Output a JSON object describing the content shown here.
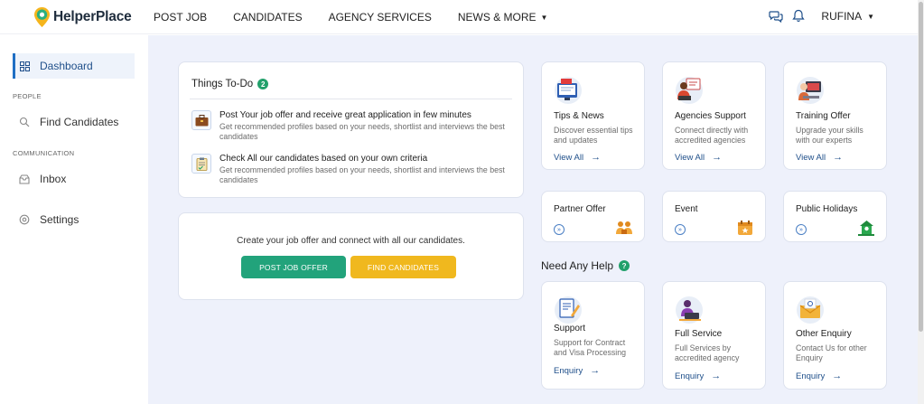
{
  "brand": {
    "name": "HelperPlace"
  },
  "nav": {
    "items": [
      {
        "label": "POST JOB"
      },
      {
        "label": "CANDIDATES"
      },
      {
        "label": "AGENCY SERVICES"
      },
      {
        "label": "NEWS & MORE",
        "has_dropdown": true
      }
    ],
    "user_name": "RUFINA"
  },
  "sidebar": {
    "items": [
      {
        "label": "Dashboard",
        "icon": "grid-icon",
        "active": true
      },
      {
        "heading": "PEOPLE"
      },
      {
        "label": "Find Candidates",
        "icon": "search-icon"
      },
      {
        "heading": "COMMUNICATION"
      },
      {
        "label": "Inbox",
        "icon": "inbox-icon"
      },
      {
        "label": "Settings",
        "icon": "settings-icon"
      }
    ]
  },
  "todo": {
    "title": "Things To-Do",
    "count": "2",
    "items": [
      {
        "head": "Post Your job offer and receive great application in few minutes",
        "sub": "Get recommended profiles based on your needs, shortlist and interviews the best candidates",
        "icon": "briefcase-icon"
      },
      {
        "head": "Check All our candidates based on your own criteria",
        "sub": "Get recommended profiles based on your needs, shortlist and interviews the best candidates",
        "icon": "checklist-icon"
      }
    ]
  },
  "create": {
    "text": "Create your job offer and connect with all our candidates.",
    "post_job": "POST JOB OFFER",
    "find_candidates": "FIND CANDIDATES"
  },
  "tiles": [
    {
      "title": "Tips & News",
      "sub": "Discover essential tips and updates",
      "link": "View All",
      "icon": "news-icon"
    },
    {
      "title": "Agencies Support",
      "sub": "Connect directly with accredited agencies",
      "link": "View All",
      "icon": "agency-icon"
    },
    {
      "title": "Training Offer",
      "sub": "Upgrade your skills with our experts",
      "link": "View All",
      "icon": "training-icon"
    }
  ],
  "small_tiles": [
    {
      "title": "Partner Offer",
      "icon": "partner-icon"
    },
    {
      "title": "Event",
      "icon": "calendar-icon"
    },
    {
      "title": "Public Holidays",
      "icon": "holiday-icon"
    }
  ],
  "help": {
    "title": "Need Any Help",
    "tiles": [
      {
        "title": "Support",
        "sub": "Support for Contract and Visa Processing",
        "link": "Enquiry",
        "icon": "support-icon"
      },
      {
        "title": "Full Service",
        "sub": "Full Services by accredited agency",
        "link": "Enquiry",
        "icon": "full-service-icon"
      },
      {
        "title": "Other Enquiry",
        "sub": "Contact Us for other Enquiry",
        "link": "Enquiry",
        "icon": "enquiry-icon"
      }
    ]
  },
  "colors": {
    "accent_green": "#22a37b",
    "accent_yellow": "#f0b81e",
    "link_blue": "#1f4f8a",
    "main_bg": "#eef1fb"
  }
}
